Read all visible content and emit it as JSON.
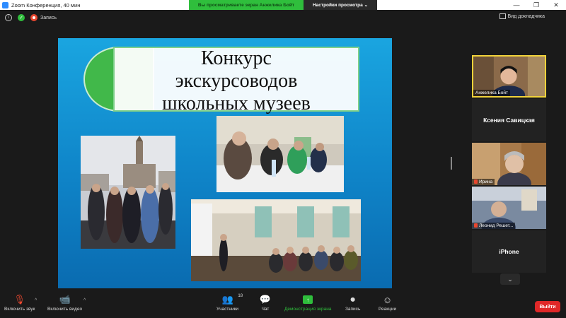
{
  "window": {
    "title": "Zoom Конференция, 40 мин",
    "controls": [
      "—",
      "❐",
      "✕"
    ]
  },
  "share_banner": {
    "text": "Вы просматриваете экран Анжелика Бойт",
    "options": "Настройки просмотра ⌄"
  },
  "topbar": {
    "recording_label": "Запись",
    "view_label": "Вид докладчика"
  },
  "slide": {
    "title_lines": [
      "Конкурс",
      "экскурсоводов",
      "школьных музеев"
    ]
  },
  "gallery": {
    "tiles": [
      {
        "name": "Анжелика Бойт",
        "type": "video",
        "active": true
      },
      {
        "name": "Ксения Савицкая",
        "type": "name"
      },
      {
        "name": "Ирина",
        "type": "video",
        "muted": true
      },
      {
        "name": "Леонид Решет...",
        "type": "video",
        "muted": true
      },
      {
        "name": "iPhone",
        "type": "name"
      }
    ],
    "scroll_icon": "⌄"
  },
  "toolbar": {
    "unmute": "Включить звук",
    "start_video": "Включить видео",
    "participants": "Участники",
    "participants_count": "18",
    "chat": "Чат",
    "share_screen": "Демонстрация экрана",
    "record": "Запись",
    "reactions": "Реакции",
    "leave": "Выйти"
  },
  "colors": {
    "accent_green": "#2fbe3c",
    "leave_red": "#e02828",
    "active_speaker": "#f0d23a",
    "slide_blue": "#1aa5e0"
  }
}
